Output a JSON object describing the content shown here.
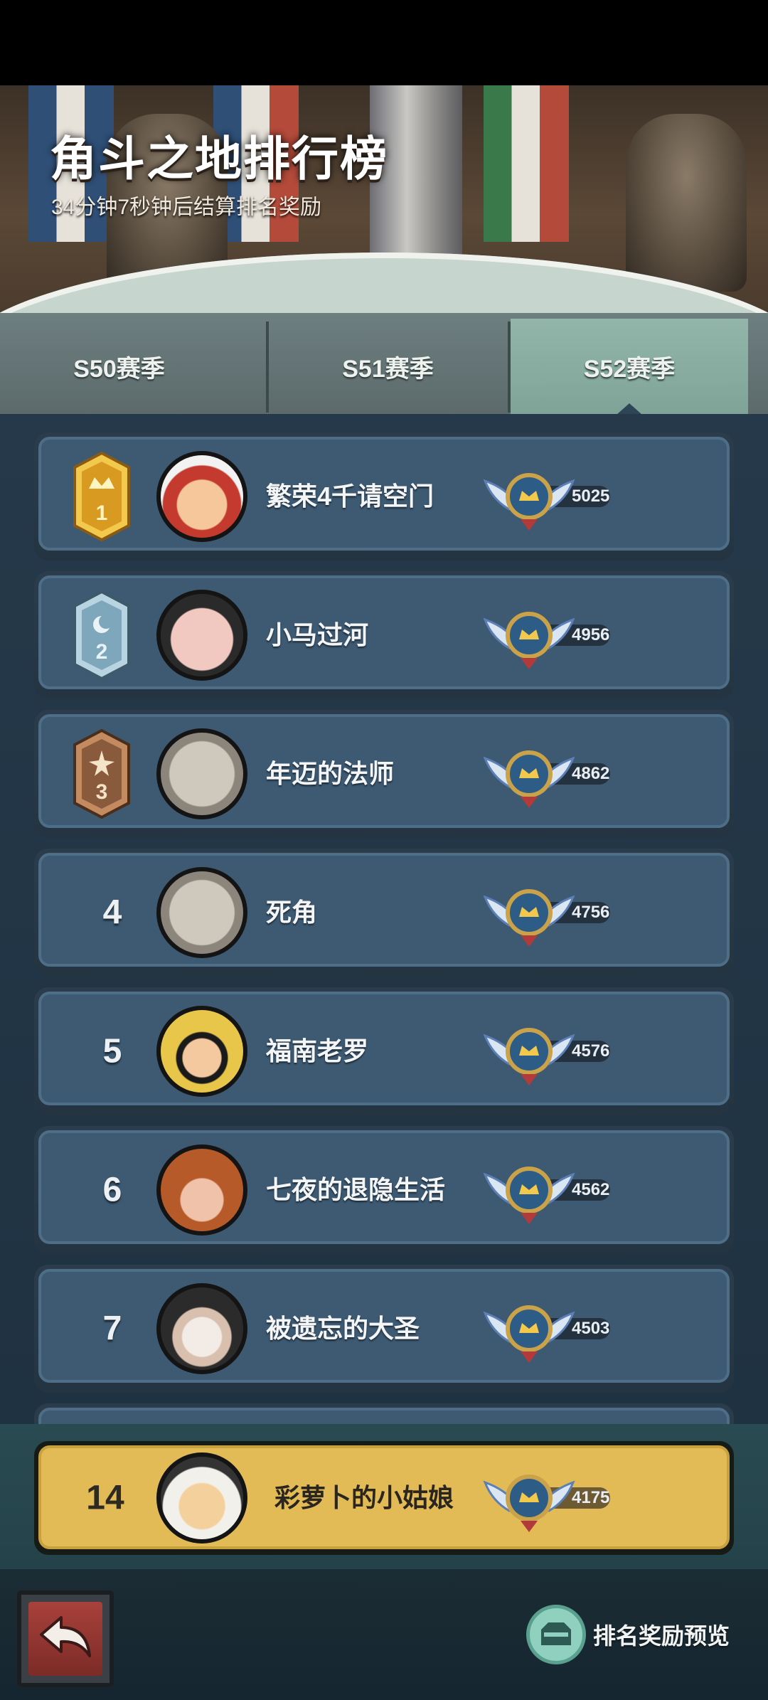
{
  "header": {
    "title": "角斗之地排行榜",
    "subtitle": "34分钟7秒钟后结算排名奖励"
  },
  "tabs": [
    {
      "label": "S50赛季",
      "selected": false
    },
    {
      "label": "S51赛季",
      "selected": false
    },
    {
      "label": "S52赛季",
      "selected": true
    }
  ],
  "leaderboard": [
    {
      "rank": "1",
      "name": "繁荣4千请空门",
      "score": "5025",
      "badge": "gold-crown-badge"
    },
    {
      "rank": "2",
      "name": "小马过河",
      "score": "4956",
      "badge": "silver-moon-badge"
    },
    {
      "rank": "3",
      "name": "年迈的法师",
      "score": "4862",
      "badge": "bronze-star-badge"
    },
    {
      "rank": "4",
      "name": "死角",
      "score": "4756"
    },
    {
      "rank": "5",
      "name": "福南老罗",
      "score": "4576"
    },
    {
      "rank": "6",
      "name": "七夜的退隐生活",
      "score": "4562"
    },
    {
      "rank": "7",
      "name": "被遗忘的大圣",
      "score": "4503"
    }
  ],
  "my_rank": {
    "rank": "14",
    "name": "彩萝卜的小姑娘",
    "score": "4175"
  },
  "footer": {
    "preview_label": "排名奖励预览"
  },
  "colors": {
    "gold_badge": "#e7b43c",
    "silver_badge": "#8fb4c6",
    "bronze_badge": "#9a6a4a",
    "highlight_row": "#e2ba56",
    "row_bg": "#3d5a72"
  }
}
